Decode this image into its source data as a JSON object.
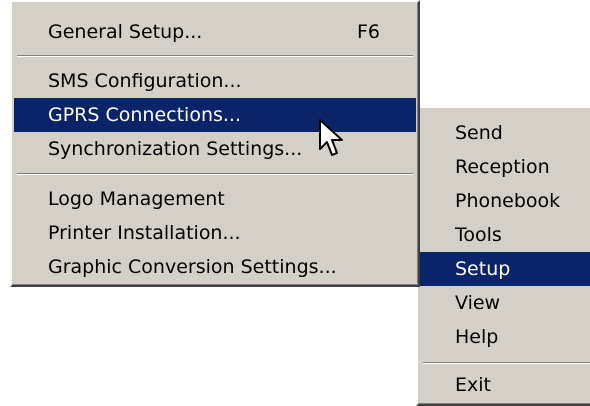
{
  "setup_menu": {
    "items": [
      {
        "label": "General Setup...",
        "shortcut": "F6"
      },
      {
        "label": "SMS Configuration..."
      },
      {
        "label": "GPRS Connections..."
      },
      {
        "label": "Synchronization Settings..."
      },
      {
        "label": "Logo Management"
      },
      {
        "label": "Printer Installation..."
      },
      {
        "label": "Graphic Conversion Settings..."
      }
    ],
    "highlighted": "GPRS Connections..."
  },
  "main_menu": {
    "items": [
      {
        "label": "Send"
      },
      {
        "label": "Reception"
      },
      {
        "label": "Phonebook"
      },
      {
        "label": "Tools"
      },
      {
        "label": "Setup"
      },
      {
        "label": "View"
      },
      {
        "label": "Help"
      },
      {
        "label": "Exit"
      }
    ],
    "highlighted": "Setup"
  },
  "colors": {
    "menu_bg": "#d4d0c8",
    "highlight_bg": "#0a246a",
    "highlight_text": "#ffffff"
  },
  "icons": {
    "submenu_arrow": "triangle-right-icon",
    "pointer": "mouse-pointer-icon"
  }
}
